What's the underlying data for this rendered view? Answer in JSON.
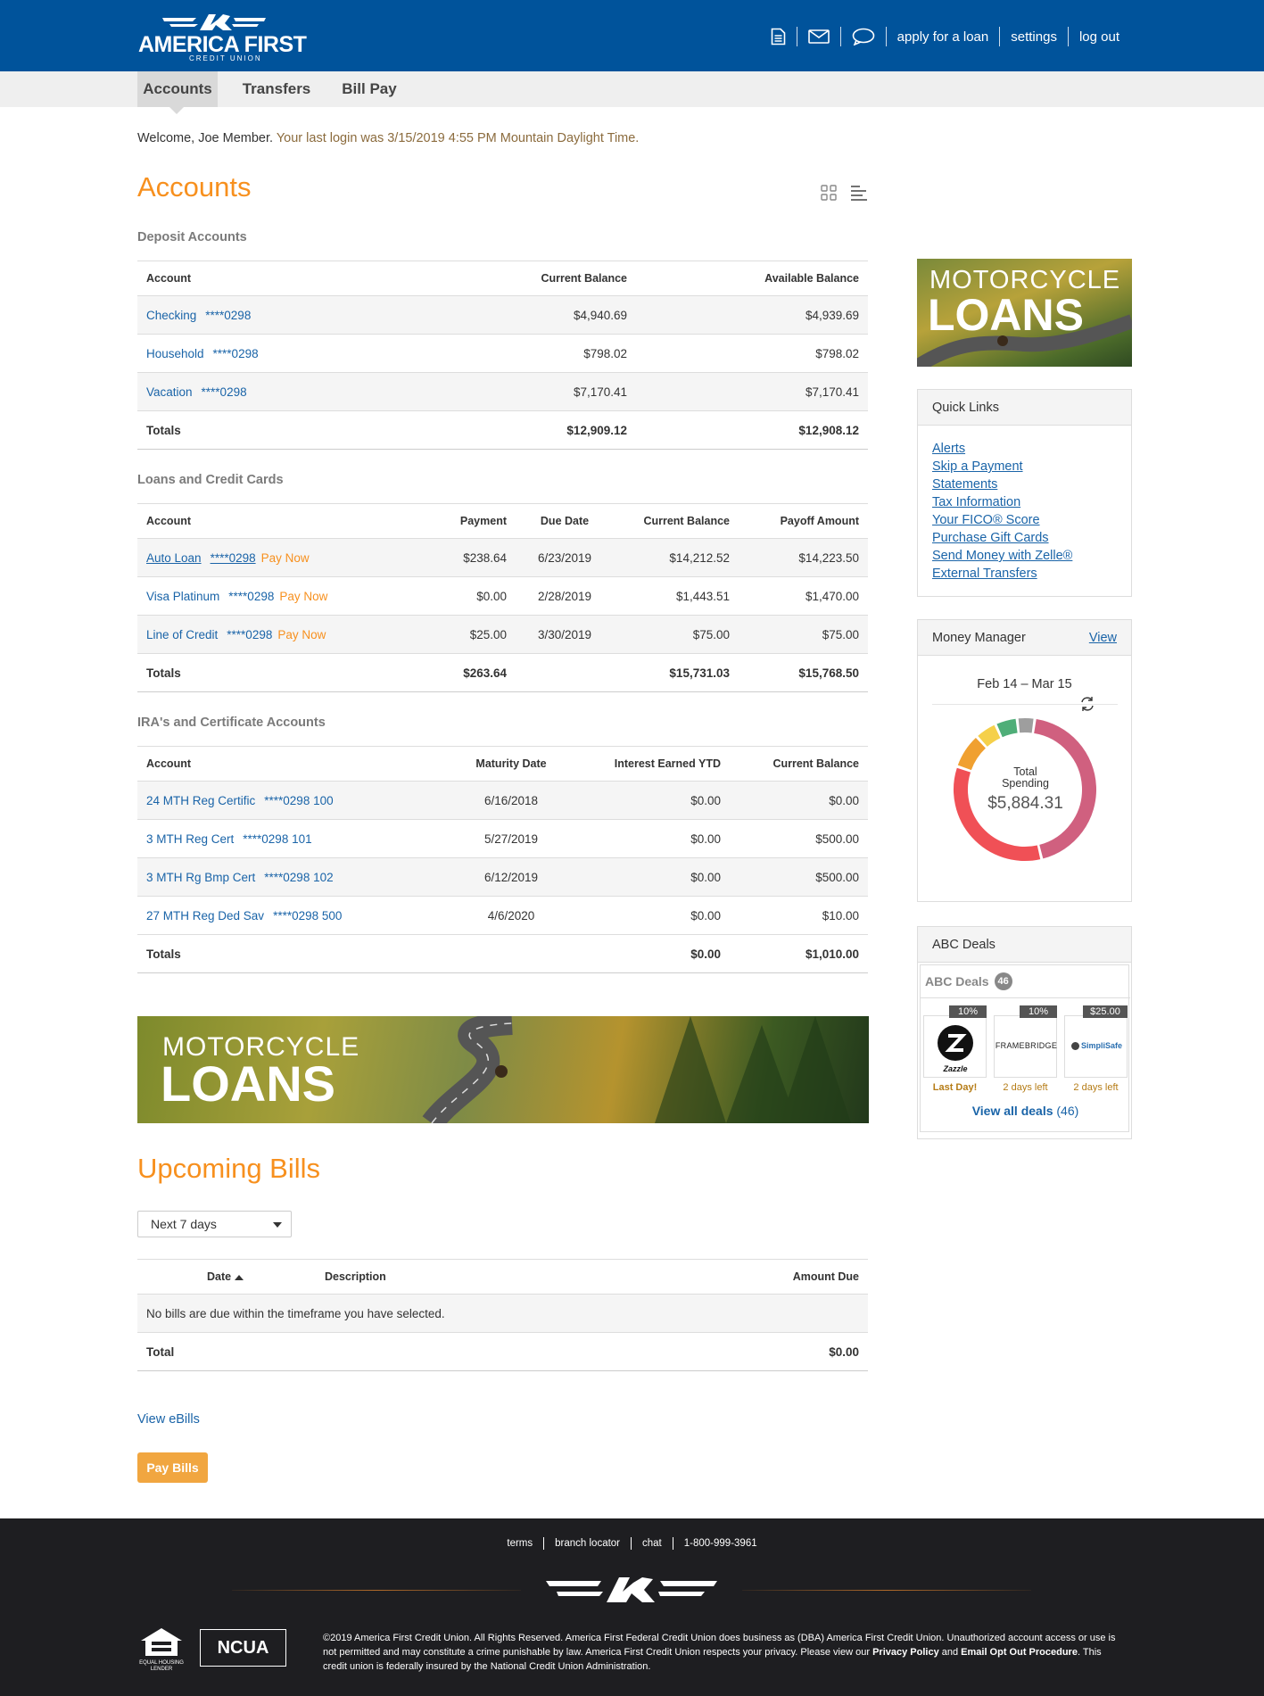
{
  "header": {
    "logo_text": "AMERICA FIRST",
    "logo_sub": "CREDIT UNION",
    "icons": [
      "document-icon",
      "mail-icon",
      "chat-icon"
    ],
    "links": [
      "apply for a loan",
      "settings",
      "log out"
    ]
  },
  "tabs": [
    "Accounts",
    "Transfers",
    "Bill Pay"
  ],
  "welcome": {
    "greeting": "Welcome, Joe Member.",
    "last_login": "Your last login was 3/15/2019 4:55 PM Mountain Daylight Time."
  },
  "accounts": {
    "title": "Accounts",
    "deposit": {
      "title": "Deposit Accounts",
      "headers": [
        "Account",
        "Current Balance",
        "Available Balance"
      ],
      "rows": [
        {
          "name": "Checking",
          "num": "****0298",
          "current": "$4,940.69",
          "available": "$4,939.69"
        },
        {
          "name": "Household",
          "num": "****0298",
          "current": "$798.02",
          "available": "$798.02"
        },
        {
          "name": "Vacation",
          "num": "****0298",
          "current": "$7,170.41",
          "available": "$7,170.41"
        }
      ],
      "totals": {
        "label": "Totals",
        "current": "$12,909.12",
        "available": "$12,908.12"
      }
    },
    "loans": {
      "title": "Loans and Credit Cards",
      "headers": [
        "Account",
        "Payment",
        "Due Date",
        "Current Balance",
        "Payoff Amount"
      ],
      "pay_now": "Pay Now",
      "rows": [
        {
          "name": "Auto Loan",
          "num": "****0298",
          "payment": "$238.64",
          "due": "6/23/2019",
          "current": "$14,212.52",
          "payoff": "$14,223.50"
        },
        {
          "name": "Visa Platinum",
          "num": "****0298",
          "payment": "$0.00",
          "due": "2/28/2019",
          "current": "$1,443.51",
          "payoff": "$1,470.00"
        },
        {
          "name": "Line of Credit",
          "num": "****0298",
          "payment": "$25.00",
          "due": "3/30/2019",
          "current": "$75.00",
          "payoff": "$75.00"
        }
      ],
      "totals": {
        "label": "Totals",
        "payment": "$263.64",
        "current": "$15,731.03",
        "payoff": "$15,768.50"
      }
    },
    "ira": {
      "title": "IRA's and Certificate Accounts",
      "headers": [
        "Account",
        "Maturity Date",
        "Interest Earned YTD",
        "Current Balance"
      ],
      "rows": [
        {
          "name": "24 MTH Reg Certific",
          "num": "****0298 100",
          "maturity": "6/16/2018",
          "interest": "$0.00",
          "balance": "$0.00"
        },
        {
          "name": "3 MTH Reg Cert",
          "num": "****0298 101",
          "maturity": "5/27/2019",
          "interest": "$0.00",
          "balance": "$500.00"
        },
        {
          "name": "3 MTH Rg Bmp Cert",
          "num": "****0298 102",
          "maturity": "6/12/2019",
          "interest": "$0.00",
          "balance": "$500.00"
        },
        {
          "name": "27 MTH Reg Ded Sav",
          "num": "****0298 500",
          "maturity": "4/6/2020",
          "interest": "$0.00",
          "balance": "$10.00"
        }
      ],
      "totals": {
        "label": "Totals",
        "interest": "$0.00",
        "balance": "$1,010.00"
      }
    }
  },
  "promo": {
    "line1": "MOTORCYCLE",
    "line2": "LOANS"
  },
  "bills": {
    "title": "Upcoming Bills",
    "range_select": "Next 7 days",
    "headers": [
      "Date",
      "Description",
      "Amount Due"
    ],
    "empty_message": "No bills are due within the timeframe you have selected.",
    "total_label": "Total",
    "total_value": "$0.00",
    "view_ebills": "View eBills",
    "pay_bills": "Pay Bills"
  },
  "quick_links": {
    "title": "Quick Links",
    "items": [
      "Alerts",
      "Skip a Payment",
      "Statements",
      "Tax Information",
      "Your FICO® Score",
      "Purchase Gift Cards",
      "Send Money with Zelle®",
      "External Transfers"
    ]
  },
  "money_manager": {
    "title": "Money Manager",
    "view": "View",
    "range": "Feb 14 – Mar 15",
    "center_label": "Total Spending",
    "center_value": "$5,884.31",
    "slices": [
      {
        "color": "#d0607f",
        "value": 0.44
      },
      {
        "color": "#f05056",
        "value": 0.34
      },
      {
        "color": "#f0a030",
        "value": 0.08
      },
      {
        "color": "#f5d04a",
        "value": 0.05
      },
      {
        "color": "#4fae78",
        "value": 0.05
      },
      {
        "color": "#9e9e9e",
        "value": 0.04
      }
    ]
  },
  "deals": {
    "title": "ABC Deals",
    "inner_title": "ABC Deals",
    "count": "46",
    "items": [
      {
        "tag": "10%",
        "brand": "Zazzle",
        "status": "Last Day!"
      },
      {
        "tag": "10%",
        "brand": "FRAMEBRIDGE",
        "status": "2 days left"
      },
      {
        "tag": "$25.00",
        "brand": "SimpliSafe",
        "status": "2 days left"
      }
    ],
    "view_all": "View all deals",
    "view_all_count": "(46)"
  },
  "footer": {
    "links": [
      "terms",
      "branch locator",
      "chat",
      "1-800-999-3961"
    ],
    "ehl": "EQUAL HOUSING LENDER",
    "ncua": "NCUA",
    "legal_1": "©2019 America First Credit Union. All Rights Reserved. America First Federal Credit Union does business as (DBA) America First Credit Union. Unauthorized account access or use is not permitted and may constitute a crime punishable by law. America First Credit Union respects your privacy. Please view our ",
    "privacy": "Privacy Policy",
    "and": " and ",
    "optout": "Email Opt Out Procedure",
    "legal_2": ". This credit union is federally insured by the National Credit Union Administration."
  },
  "colors": {
    "brand_blue": "#00539b",
    "accent_orange": "#f7901e",
    "link_blue": "#1a64a8",
    "footer_bg": "#1e1e21"
  }
}
